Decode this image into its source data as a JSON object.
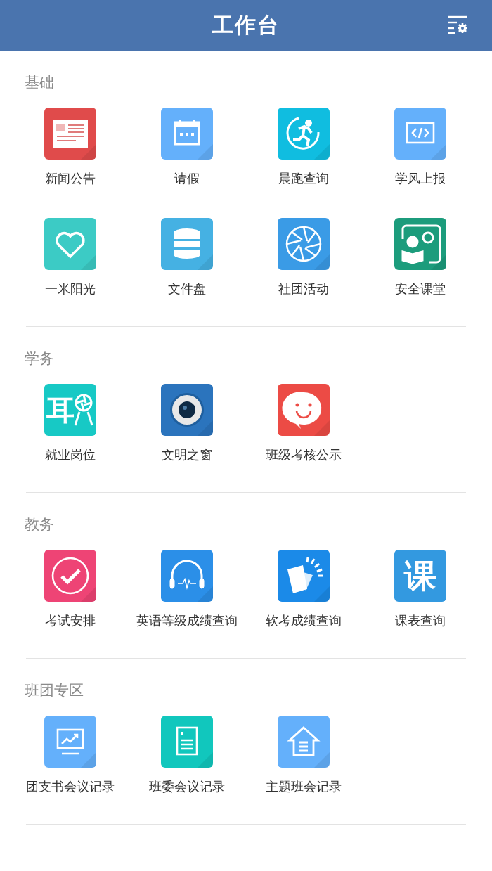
{
  "header": {
    "title": "工作台"
  },
  "sections": [
    {
      "title": "基础",
      "items": [
        {
          "label": "新闻公告",
          "kind": "news",
          "color": "#e04b4b"
        },
        {
          "label": "请假",
          "kind": "calendar",
          "color": "#64b0fb"
        },
        {
          "label": "晨跑查询",
          "kind": "runner",
          "color": "#10bde0"
        },
        {
          "label": "学风上报",
          "kind": "code",
          "color": "#64b0fb"
        },
        {
          "label": "一米阳光",
          "kind": "heart",
          "color": "#3ccbc5"
        },
        {
          "label": "文件盘",
          "kind": "database",
          "color": "#45b1e3"
        },
        {
          "label": "社团活动",
          "kind": "shutter",
          "color": "#3a9be6"
        },
        {
          "label": "安全课堂",
          "kind": "reader",
          "color": "#1c9c7c"
        }
      ]
    },
    {
      "title": "学务",
      "items": [
        {
          "label": "就业岗位",
          "kind": "job",
          "color": "#17c9c5",
          "glyph": "耳"
        },
        {
          "label": "文明之窗",
          "kind": "lens",
          "color": "#2b74bd"
        },
        {
          "label": "班级考核公示",
          "kind": "smile",
          "color": "#ec4b45"
        }
      ]
    },
    {
      "title": "教务",
      "items": [
        {
          "label": "考试安排",
          "kind": "check",
          "color": "#ee4475"
        },
        {
          "label": "英语等级成绩查询",
          "kind": "headphones",
          "color": "#2b8fe8"
        },
        {
          "label": "软考成绩查询",
          "kind": "book",
          "color": "#1b8ae8"
        },
        {
          "label": "课表查询",
          "kind": "glyph",
          "color": "#3399e0",
          "glyph": "课"
        }
      ]
    },
    {
      "title": "班团专区",
      "items": [
        {
          "label": "团支书会议记录",
          "kind": "chart",
          "color": "#64b0fb"
        },
        {
          "label": "班委会议记录",
          "kind": "document",
          "color": "#11c7bd"
        },
        {
          "label": "主题班会记录",
          "kind": "house",
          "color": "#64b0fb"
        }
      ]
    }
  ]
}
